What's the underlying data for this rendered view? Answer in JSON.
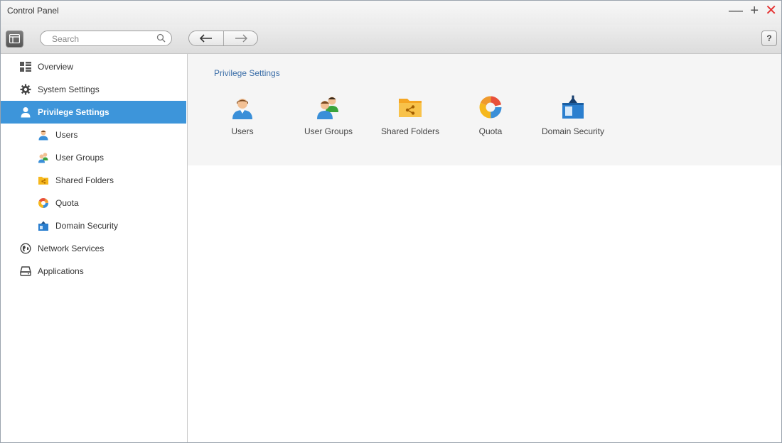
{
  "window": {
    "title": "Control Panel"
  },
  "toolbar": {
    "search_placeholder": "Search",
    "search_value": "",
    "help_label": "?"
  },
  "sidebar": {
    "items": [
      {
        "label": "Overview",
        "icon": "overview-icon"
      },
      {
        "label": "System Settings",
        "icon": "gear-icon"
      },
      {
        "label": "Privilege Settings",
        "icon": "user-icon",
        "selected": true
      },
      {
        "label": "Users",
        "icon": "user-icon"
      },
      {
        "label": "User Groups",
        "icon": "user-group-icon"
      },
      {
        "label": "Shared Folders",
        "icon": "shared-folder-icon"
      },
      {
        "label": "Quota",
        "icon": "quota-pie-icon"
      },
      {
        "label": "Domain Security",
        "icon": "domain-security-icon"
      },
      {
        "label": "Network Services",
        "icon": "globe-icon"
      },
      {
        "label": "Applications",
        "icon": "drive-icon"
      }
    ]
  },
  "main": {
    "section_title": "Privilege Settings",
    "tiles": [
      {
        "label": "Users",
        "icon": "user-icon"
      },
      {
        "label": "User Groups",
        "icon": "user-group-icon"
      },
      {
        "label": "Shared Folders",
        "icon": "shared-folder-icon"
      },
      {
        "label": "Quota",
        "icon": "quota-pie-icon"
      },
      {
        "label": "Domain Security",
        "icon": "domain-security-icon"
      }
    ]
  },
  "colors": {
    "accent": "#3d95da",
    "close": "#e53333",
    "section_title": "#3b6ea8"
  }
}
